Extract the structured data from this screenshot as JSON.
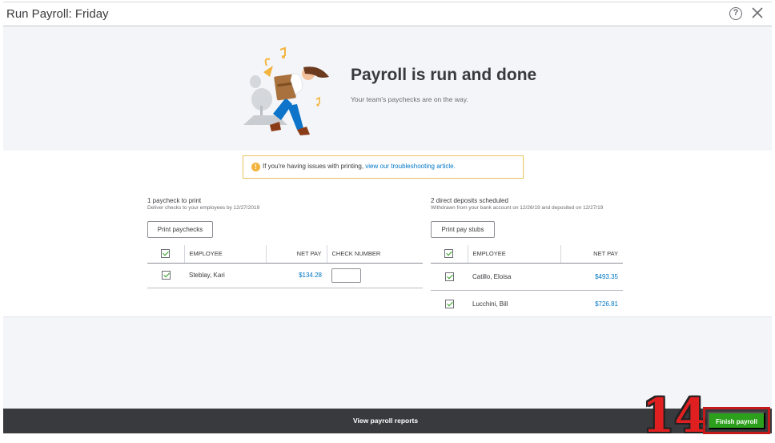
{
  "window": {
    "title": "Run Payroll: Friday"
  },
  "hero": {
    "heading": "Payroll is run and done",
    "subtext": "Your team's paychecks are on the way."
  },
  "notice": {
    "text": "If you're having issues with printing,",
    "link": "view our troubleshooting article."
  },
  "checks": {
    "heading": "1 paycheck to print",
    "subheading": "Deliver checks to your employees by 12/27/2019",
    "button": "Print paychecks",
    "columns": [
      "EMPLOYEE",
      "NET PAY",
      "CHECK NUMBER"
    ],
    "rows": [
      {
        "employee": "Steblay, Kari",
        "net_pay": "$134.28",
        "check_number": ""
      }
    ]
  },
  "deposits": {
    "heading": "2 direct deposits scheduled",
    "subheading": "Withdrawn from your bank account on 12/26/19 and deposited on 12/27/19",
    "button": "Print pay stubs",
    "columns": [
      "EMPLOYEE",
      "NET PAY"
    ],
    "rows": [
      {
        "employee": "Catillo, Eloisa",
        "net_pay": "$493.35"
      },
      {
        "employee": "Lucchini, Bill",
        "net_pay": "$726.81"
      }
    ]
  },
  "footer": {
    "reports_label": "View payroll reports",
    "finish_label": "Finish payroll",
    "step_number": "14"
  },
  "colors": {
    "accent_green": "#2ca01c",
    "link_blue": "#0077c5",
    "footer_dark": "#393a3d",
    "callout_red": "#c51a1a"
  }
}
